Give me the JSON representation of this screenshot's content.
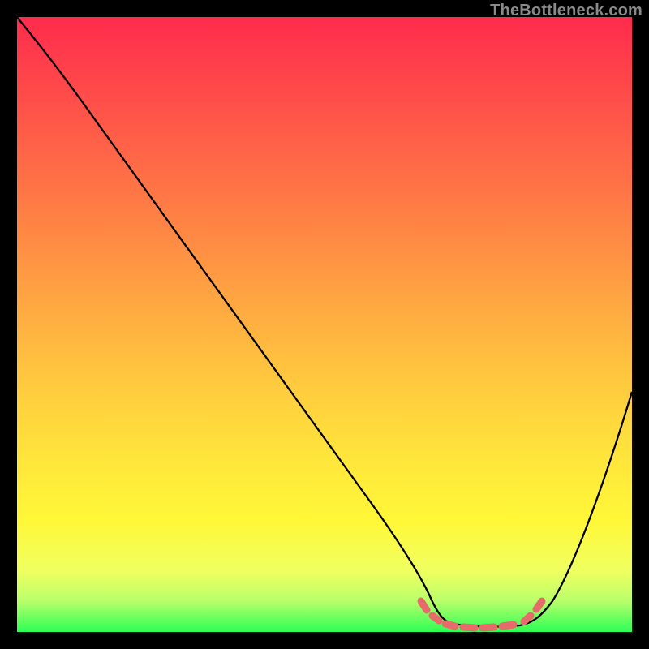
{
  "watermark": "TheBottleneck.com",
  "chart_data": {
    "type": "line",
    "title": "",
    "xlabel": "",
    "ylabel": "",
    "xlim": [
      0,
      100
    ],
    "ylim": [
      0,
      100
    ],
    "x": [
      0,
      6,
      12,
      18,
      24,
      30,
      36,
      42,
      48,
      54,
      60,
      64,
      67,
      70,
      73,
      76,
      79,
      82,
      85,
      90,
      95,
      100
    ],
    "values": [
      100,
      96,
      90,
      83,
      75,
      67,
      59,
      51,
      43,
      35,
      26,
      16,
      8,
      3,
      1,
      1,
      1,
      3,
      8,
      18,
      28,
      39
    ],
    "flat_segment": {
      "x_start": 65,
      "x_end": 84,
      "note": "thick salmon dashed band at valley"
    },
    "background_gradient": {
      "top": "#ff2b4d",
      "mid": "#ffe63b",
      "bottom": "#2bff55"
    }
  }
}
